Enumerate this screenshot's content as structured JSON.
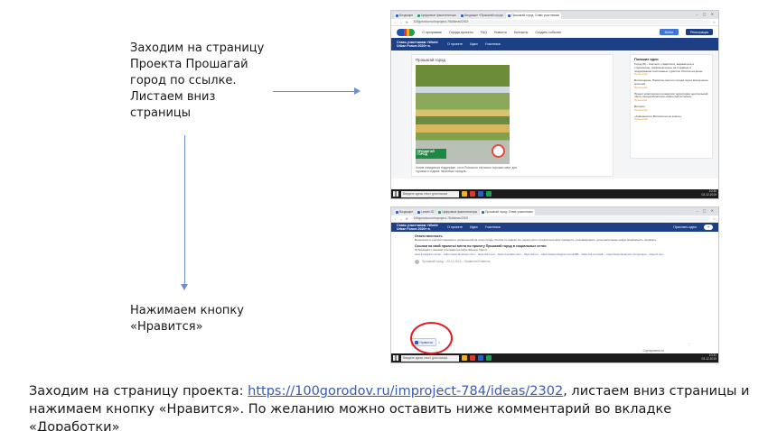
{
  "instructions": {
    "step1": "Заходим на страницу Проекта Прошагай город по ссылке. Листаем вниз страницы",
    "step2": "Нажимаем кнопку «Нравится»"
  },
  "caption": {
    "before": "Заходим на страницу проекта: ",
    "link": "https://100gorodov.ru/improject-784/ideas/2302",
    "after": ", листаем вниз страницы и нажимаем кнопку «Нравится». По желанию можно оставить ниже комментарий во вкладке «Доработки»"
  },
  "browser1": {
    "tabs": [
      "Входящие",
      "Цифровые фасилитаторы",
      "Входящие «Прошагай город»",
      "Прошагай город: Ставь участникам"
    ],
    "url": "100gorodov.ru/improject-784/ideas/2302",
    "nav": {
      "items": [
        "О программе",
        "Города-проекты",
        "FAQ",
        "Новости",
        "Контакты",
        "Создать событие"
      ],
      "login": "Войти",
      "register": "Регистрация"
    },
    "bluebar": {
      "title": "Ставь участникам «World Urban Forum 2020» в.",
      "links": [
        "О проекте",
        "Идеи",
        "Участники"
      ]
    },
    "idea": {
      "title": "Прошагай город",
      "sign": "ПРОШАГАЙ ГОРОД",
      "caption": "Хотим попадаться поддержке, что в России не так много хороших мест для туризма и отдыха: несколько городов.."
    },
    "sidebar": {
      "heading": "Похожие идеи",
      "ideas": [
        {
          "title": "Город 86 – Контекст, смартсити, выразитель и стремление: привлекательно на создание и поддержание постоянных туристов. Россия на фоне",
          "meta": "Прошагай"
        },
        {
          "title": "Воплощение. Развитие малого города через вовлечение жителей",
          "meta": "Прошагай"
        },
        {
          "title": "Проект комплексного развития территории центральной части города Монстера «Масштаб истории»",
          "meta": "Прошагай"
        },
        {
          "title": "Ветерок",
          "meta": "Прошагай"
        },
        {
          "title": "«Суверенитет Вятская на её земле»",
          "meta": "Прошагай"
        }
      ]
    },
    "taskbar": {
      "search": "Введите здесь текст для поиска",
      "time": "10:30",
      "date": "03.12.2019"
    }
  },
  "browser2": {
    "tabs": [
      "Входящие",
      "Leader-ID",
      "Цифровые фасилитаторы",
      "Прошагай город: Ставь участникам"
    ],
    "url": "100gorodov.ru/improject-784/ideas/2302",
    "bluebar": {
      "title": "Ставь участникам «World Urban Forum 2020» в.",
      "links": [
        "О проекте",
        "Идеи",
        "Участники"
      ],
      "cta": "Прислать идею"
    },
    "content": {
      "h1": "Ответственность",
      "p1": "Возможность распространения и проверенной на этом городе. Россия по новым. Не перегрузить городов величине проверить, рекламировать, дополнительные новую возможность понимать.",
      "h2": "Ссылки на свой проекты/ места по проекту Прошагай город в социальных сетях:",
      "p2": "Публикации с нашими ссылками на сайте Флешм: https://",
      "links": "www.instagram.com/p/... https://www.facebook.com/... https://vk.com/... https://youtube.com/... https://ok.ru/... https://www.instagram.com/p/B5... https://vk.com/wall-... https://www.facebook.com/groups/... https://t.me/...",
      "comment_author": "Прошагай город – 03.12.2019 – Нравится/Ответить",
      "like_label": "Нравится",
      "like_count": "1",
      "sort_label": "Сортировать по"
    },
    "taskbar": {
      "search": "Введите здесь текст для поиска",
      "time": "10:31",
      "date": "03.12.2019"
    }
  }
}
